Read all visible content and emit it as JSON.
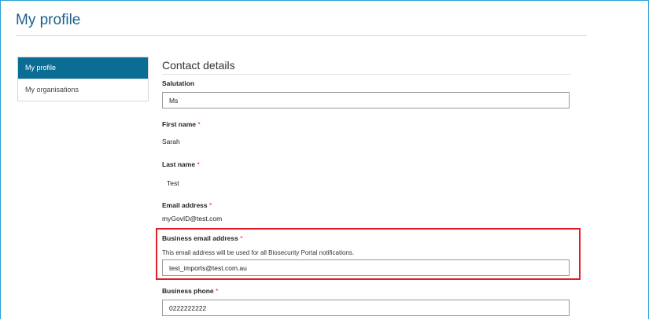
{
  "page": {
    "title": "My profile"
  },
  "sidebar": {
    "items": [
      {
        "label": "My profile"
      },
      {
        "label": "My organisations"
      }
    ]
  },
  "contact": {
    "section_title": "Contact details",
    "required_mark": "*",
    "salutation": {
      "label": "Salutation",
      "value": "Ms"
    },
    "first_name": {
      "label": "First name",
      "value": "Sarah"
    },
    "last_name": {
      "label": "Last name",
      "value": "Test"
    },
    "email": {
      "label": "Email address",
      "value": "myGovID@test.com"
    },
    "business_email": {
      "label": "Business email address",
      "hint": "This email address will be used for all Biosecurity Portal notifications.",
      "value": "test_imports@test.com.au"
    },
    "business_phone": {
      "label": "Business phone",
      "value": "0222222222"
    }
  },
  "colors": {
    "accent": "#0b6d93",
    "title": "#1c5f8c",
    "highlight": "#e02027",
    "required": "#dd2233"
  }
}
